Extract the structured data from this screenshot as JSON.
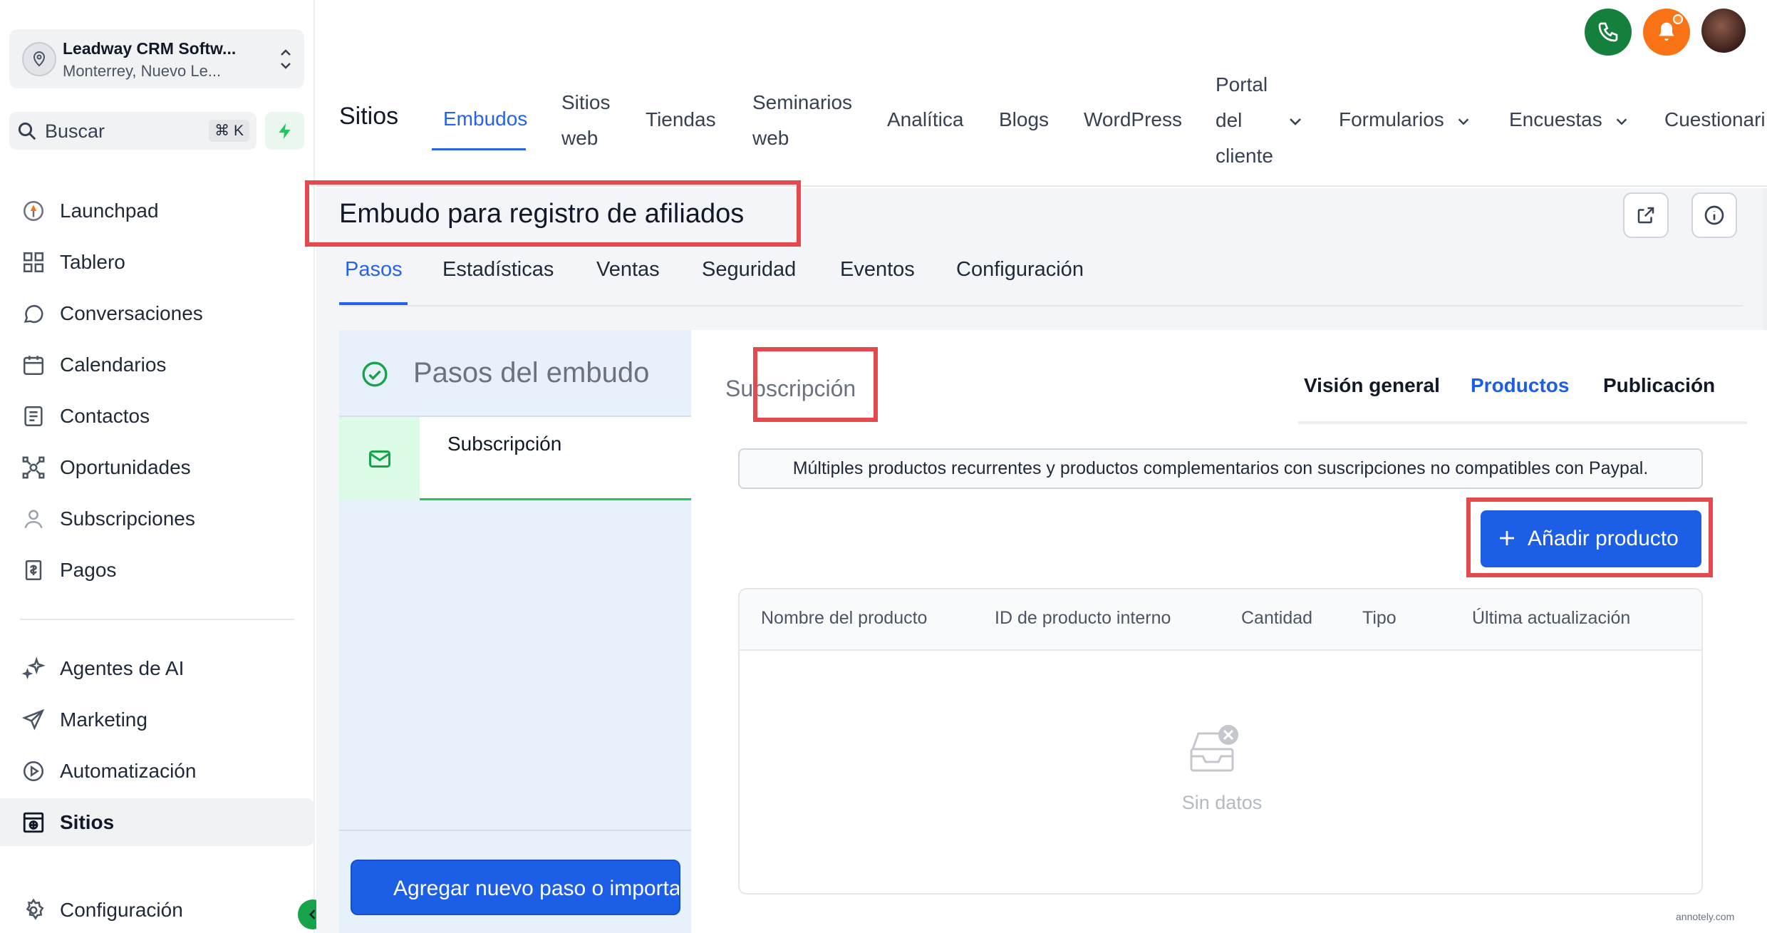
{
  "account": {
    "name": "Leadway CRM Softw...",
    "location": "Monterrey, Nuevo Le..."
  },
  "search": {
    "label": "Buscar",
    "shortcut": "⌘ K"
  },
  "sidebar": {
    "items": [
      {
        "label": "Launchpad",
        "icon": "rocket-icon"
      },
      {
        "label": "Tablero",
        "icon": "dashboard-icon"
      },
      {
        "label": "Conversaciones",
        "icon": "chat-icon"
      },
      {
        "label": "Calendarios",
        "icon": "calendar-icon"
      },
      {
        "label": "Contactos",
        "icon": "contacts-icon"
      },
      {
        "label": "Oportunidades",
        "icon": "opportunities-icon"
      },
      {
        "label": "Subscripciones",
        "icon": "subscriptions-icon"
      },
      {
        "label": "Pagos",
        "icon": "payments-icon"
      },
      {
        "label": "Agentes de AI",
        "icon": "sparkle-icon"
      },
      {
        "label": "Marketing",
        "icon": "send-icon"
      },
      {
        "label": "Automatización",
        "icon": "automation-icon"
      },
      {
        "label": "Sitios",
        "icon": "sites-icon"
      },
      {
        "label": "Configuración",
        "icon": "gear-icon"
      }
    ],
    "active": "Sitios"
  },
  "topnav": {
    "title": "Sitios",
    "items": [
      {
        "label": "Embudos"
      },
      {
        "line1": "Sitios",
        "line2": "web"
      },
      {
        "label": "Tiendas"
      },
      {
        "line1": "Seminarios",
        "line2": "web"
      },
      {
        "label": "Analítica"
      },
      {
        "label": "Blogs"
      },
      {
        "label": "WordPress"
      },
      {
        "line1": "Portal",
        "line2": "del",
        "line3": "cliente"
      },
      {
        "label": "Formularios"
      },
      {
        "label": "Encuestas"
      },
      {
        "label": "Cuestionari"
      }
    ],
    "active": "Embudos"
  },
  "funnel": {
    "title": "Embudo para registro de afiliados",
    "tabs": [
      "Pasos",
      "Estadísticas",
      "Ventas",
      "Seguridad",
      "Eventos",
      "Configuración"
    ],
    "active_tab": "Pasos"
  },
  "steps": {
    "title": "Pasos del embudo",
    "items": [
      {
        "label": "Subscripción"
      }
    ],
    "add_button": "Agregar nuevo paso o importar"
  },
  "panel": {
    "subtitle": "Subscripción",
    "tabs": [
      "Visión general",
      "Productos",
      "Publicación"
    ],
    "active_tab": "Productos",
    "notice": "Múltiples productos recurrentes y productos complementarios con suscripciones no compatibles con Paypal.",
    "add_product": "Añadir producto",
    "table": {
      "columns": [
        "Nombre del producto",
        "ID de producto interno",
        "Cantidad",
        "Tipo",
        "Última actualización"
      ],
      "rows": [],
      "empty": "Sin datos"
    }
  },
  "watermark": "annotely.com",
  "colors": {
    "accent": "#1d5ee6",
    "highlight": "#e5484d",
    "success": "#22c55e",
    "call": "#15803d",
    "bell": "#f97316"
  }
}
